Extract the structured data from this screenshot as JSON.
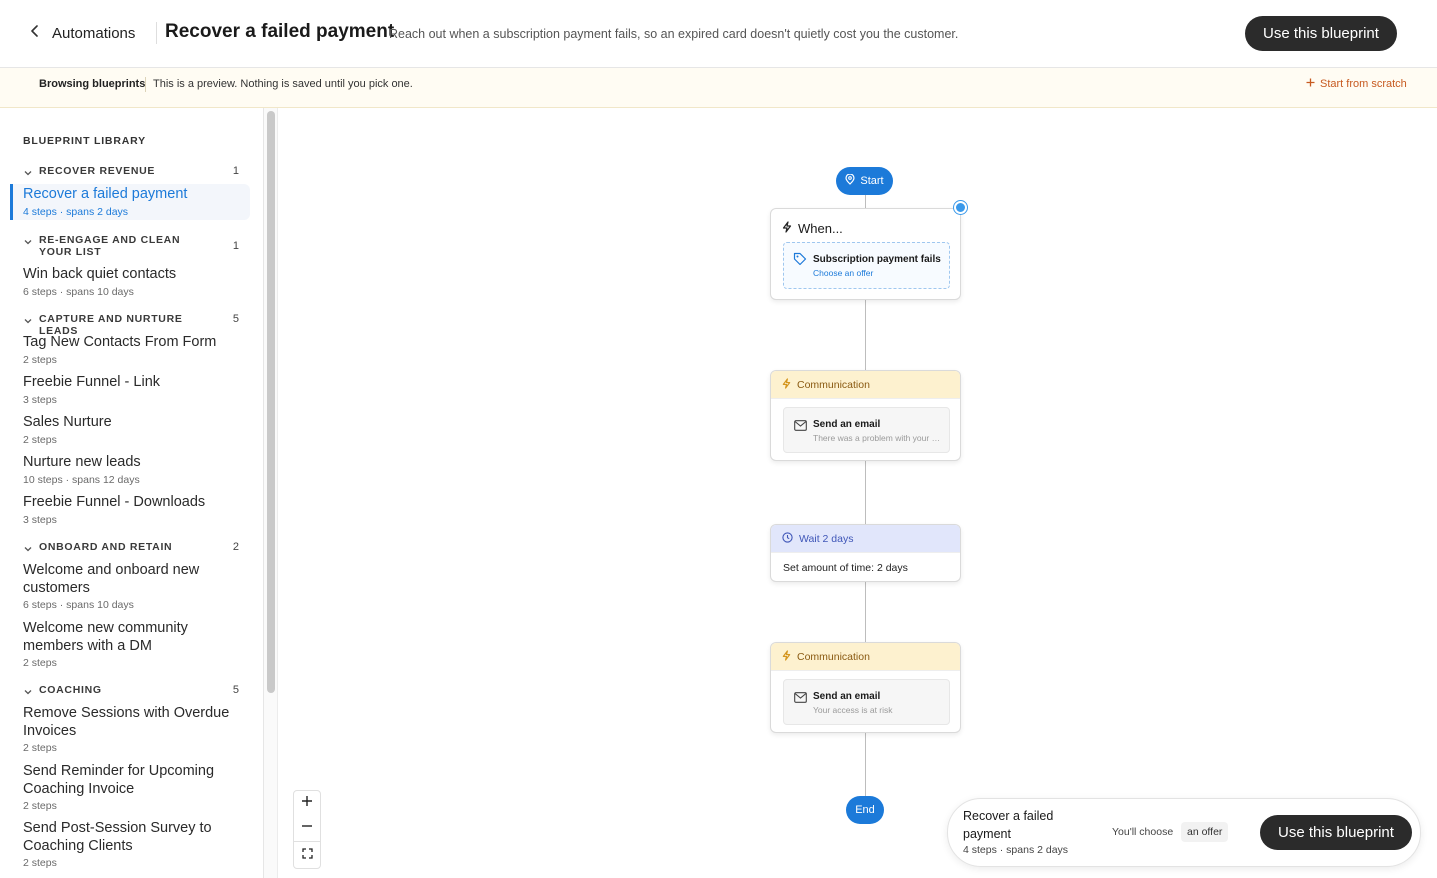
{
  "header": {
    "back_label": "Automations",
    "title": "Recover a failed payment",
    "subtitle": "Reach out when a subscription payment fails, so an expired card doesn't quietly cost you the customer.",
    "cta": "Use this blueprint"
  },
  "banner": {
    "strong": "Browsing blueprints",
    "text": "This is a preview. Nothing is saved until you pick one.",
    "scratch": "Start from scratch"
  },
  "sidebar": {
    "title": "BLUEPRINT LIBRARY",
    "categories": [
      {
        "name": "RECOVER REVENUE",
        "count": "1"
      },
      {
        "name": "RE-ENGAGE AND CLEAN YOUR LIST",
        "count": "1"
      },
      {
        "name": "CAPTURE AND NURTURE LEADS",
        "count": "5"
      },
      {
        "name": "ONBOARD AND RETAIN",
        "count": "2"
      },
      {
        "name": "COACHING",
        "count": "5"
      }
    ],
    "items": [
      {
        "name": "Recover a failed payment",
        "meta": "4 steps · spans 2 days"
      },
      {
        "name": "Win back quiet contacts",
        "meta": "6 steps · spans 10 days"
      },
      {
        "name": "Tag New Contacts From Form",
        "meta": "2 steps"
      },
      {
        "name": "Freebie Funnel - Link",
        "meta": "3 steps"
      },
      {
        "name": "Sales Nurture",
        "meta": "2 steps"
      },
      {
        "name": "Nurture new leads",
        "meta": "10 steps · spans 12 days"
      },
      {
        "name": "Freebie Funnel - Downloads",
        "meta": "3 steps"
      },
      {
        "name": "Welcome and onboard new customers",
        "meta": "6 steps · spans 10 days"
      },
      {
        "name": "Welcome new community members with a DM",
        "meta": "2 steps"
      },
      {
        "name": "Remove Sessions with Overdue Invoices",
        "meta": "2 steps"
      },
      {
        "name": "Send Reminder for Upcoming Coaching Invoice",
        "meta": "2 steps"
      },
      {
        "name": "Send Post-Session Survey to Coaching Clients",
        "meta": "2 steps"
      }
    ]
  },
  "flow": {
    "start": "Start",
    "end": "End",
    "trigger": {
      "heading": "When...",
      "title": "Subscription payment fails",
      "link": "Choose an offer"
    },
    "step1": {
      "header": "Communication",
      "title": "Send an email",
      "sub": "There was a problem with your payment"
    },
    "wait": {
      "header": "Wait 2 days",
      "body": "Set amount of time: 2 days"
    },
    "step2": {
      "header": "Communication",
      "title": "Send an email",
      "sub": "Your access is at risk"
    }
  },
  "footer": {
    "title": "Recover a failed payment",
    "meta": "4 steps · spans 2 days",
    "choose": "You'll choose",
    "chip": "an offer",
    "cta": "Use this blueprint"
  },
  "colors": {
    "accent": "#1c7ad9",
    "dark_button": "#2b2b2b",
    "communication_header": "#fdf1cf",
    "wait_header": "#e1e6fb",
    "banner_bg": "#fffcf3",
    "scratch_link": "#c75a20"
  }
}
